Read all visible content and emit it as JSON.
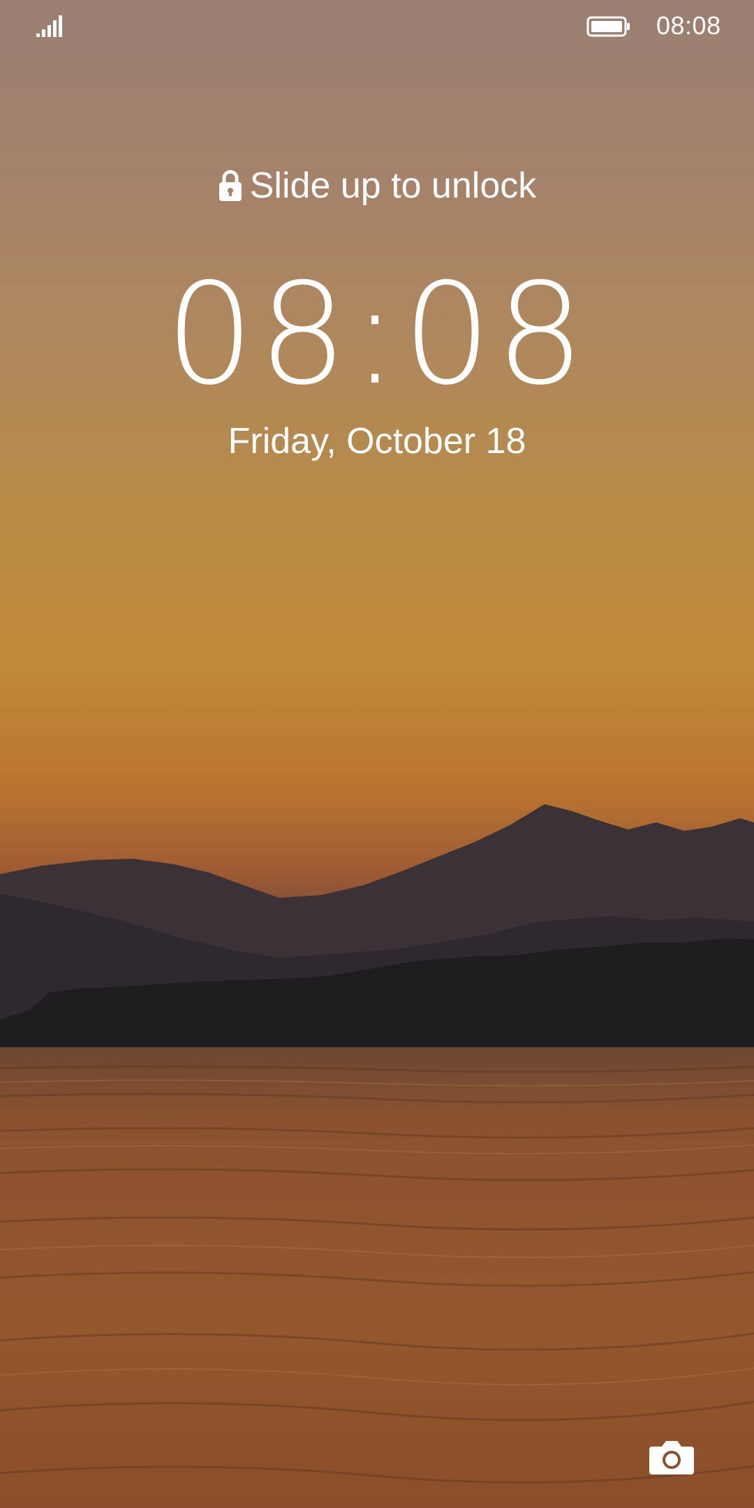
{
  "status_bar": {
    "time": "08:08",
    "signal_icon": "signal-bars-icon",
    "battery_icon": "battery-full-icon"
  },
  "lock_screen": {
    "unlock_hint": "Slide up to unlock",
    "lock_icon": "lock-icon",
    "clock": "08:08",
    "date": "Friday, October 18",
    "camera_icon": "camera-icon"
  },
  "wallpaper": {
    "sky_top": "#9a7f72",
    "sky_mid": "#bf8a38",
    "horizon": "#9d5a33",
    "mountains": "#2e2a2e",
    "water": "#8a5230"
  }
}
